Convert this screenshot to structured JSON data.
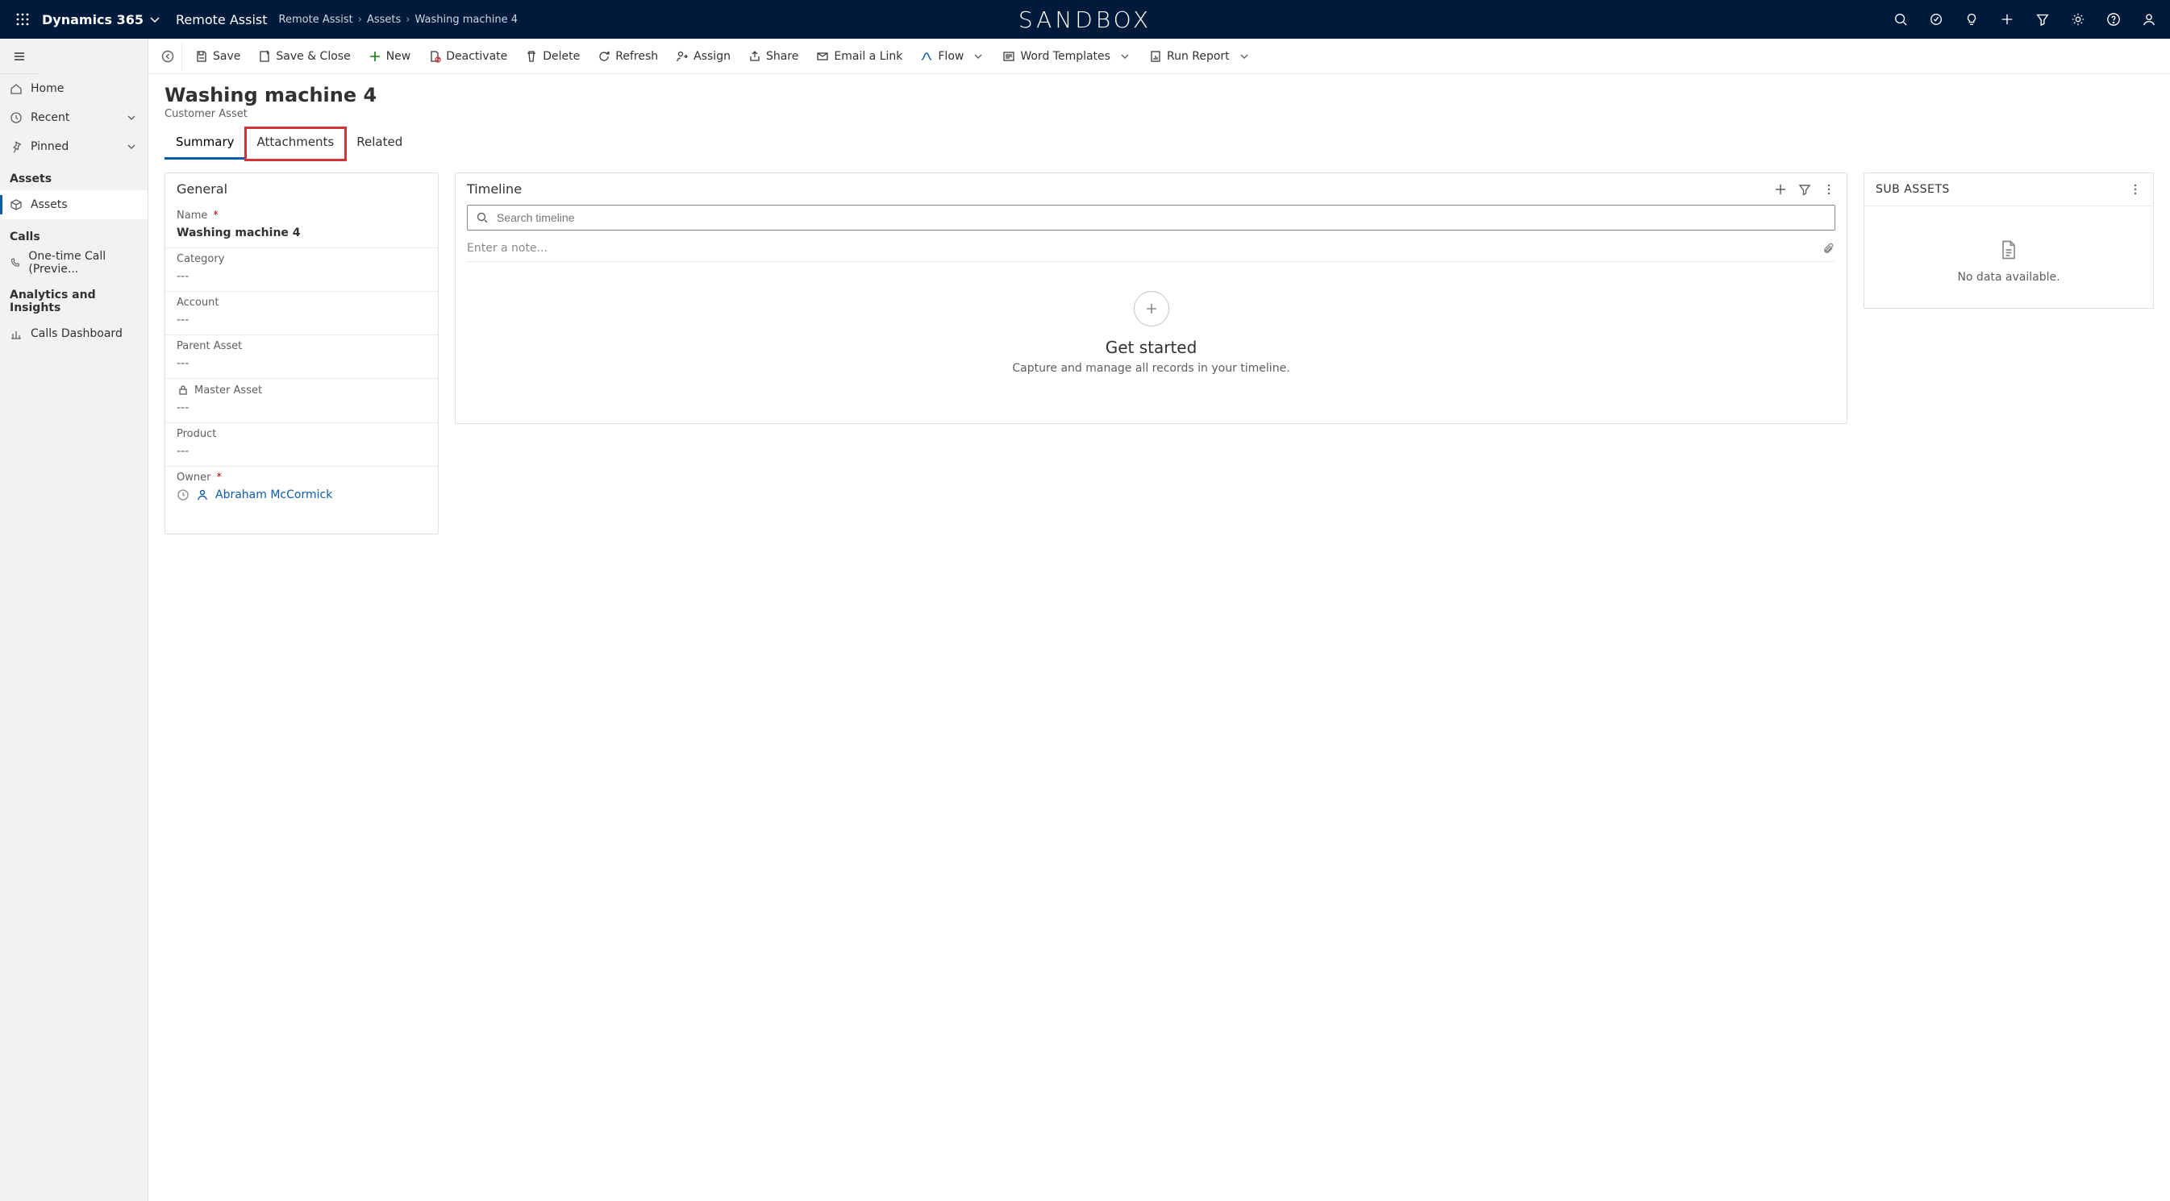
{
  "topbar": {
    "brand": "Dynamics 365",
    "app": "Remote Assist",
    "sandbox": "SANDBOX",
    "breadcrumbs": [
      "Remote Assist",
      "Assets",
      "Washing machine 4"
    ]
  },
  "sidebar": {
    "nav": {
      "home": "Home",
      "recent": "Recent",
      "pinned": "Pinned"
    },
    "groups": [
      {
        "title": "Assets",
        "items": [
          {
            "label": "Assets",
            "selected": true
          }
        ]
      },
      {
        "title": "Calls",
        "items": [
          {
            "label": "One-time Call (Previe..."
          }
        ]
      },
      {
        "title": "Analytics and Insights",
        "items": [
          {
            "label": "Calls Dashboard"
          }
        ]
      }
    ]
  },
  "commands": {
    "save": "Save",
    "save_close": "Save & Close",
    "new": "New",
    "deactivate": "Deactivate",
    "delete": "Delete",
    "refresh": "Refresh",
    "assign": "Assign",
    "share": "Share",
    "email_link": "Email a Link",
    "flow": "Flow",
    "word_templates": "Word Templates",
    "run_report": "Run Report"
  },
  "header": {
    "title": "Washing machine  4",
    "subtitle": "Customer Asset"
  },
  "tabs": [
    "Summary",
    "Attachments",
    "Related"
  ],
  "general": {
    "title": "General",
    "fields": {
      "name": {
        "label": "Name",
        "required": true,
        "value": "Washing machine  4"
      },
      "category": {
        "label": "Category",
        "value": "---"
      },
      "account": {
        "label": "Account",
        "value": "---"
      },
      "parent_asset": {
        "label": "Parent Asset",
        "value": "---"
      },
      "master_asset": {
        "label": "Master Asset",
        "locked": true,
        "value": "---"
      },
      "product": {
        "label": "Product",
        "value": "---"
      },
      "owner": {
        "label": "Owner",
        "required": true,
        "value": "Abraham McCormick"
      }
    }
  },
  "timeline": {
    "title": "Timeline",
    "search_placeholder": "Search timeline",
    "note_placeholder": "Enter a note...",
    "empty_title": "Get started",
    "empty_text": "Capture and manage all records in your timeline."
  },
  "subassets": {
    "title": "SUB ASSETS",
    "empty": "No data available."
  }
}
